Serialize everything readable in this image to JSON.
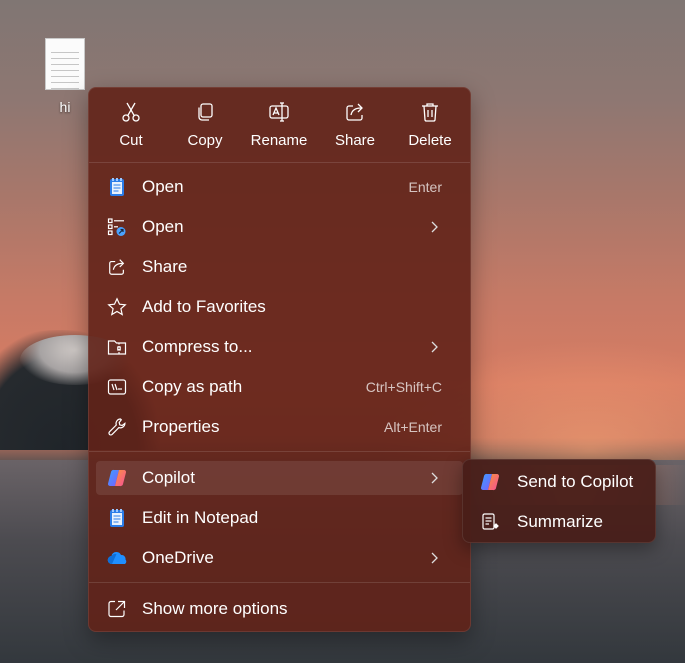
{
  "desktop": {
    "file_name": "hi"
  },
  "context_menu": {
    "actions": [
      {
        "label": "Cut",
        "icon": "scissors-icon"
      },
      {
        "label": "Copy",
        "icon": "copy-icon"
      },
      {
        "label": "Rename",
        "icon": "rename-icon"
      },
      {
        "label": "Share",
        "icon": "share-icon"
      },
      {
        "label": "Delete",
        "icon": "trash-icon"
      }
    ],
    "items": [
      {
        "label": "Open",
        "shortcut": "Enter",
        "icon": "notepad-icon"
      },
      {
        "label": "Open",
        "shortcut": "",
        "icon": "open-with-icon",
        "submenu": true
      },
      {
        "label": "Share",
        "shortcut": "",
        "icon": "share-icon"
      },
      {
        "label": "Add to Favorites",
        "shortcut": "",
        "icon": "star-icon"
      },
      {
        "label": "Compress to...",
        "shortcut": "",
        "icon": "zip-folder-icon",
        "submenu": true
      },
      {
        "label": "Copy as path",
        "shortcut": "Ctrl+Shift+C",
        "icon": "copy-path-icon"
      },
      {
        "label": "Properties",
        "shortcut": "Alt+Enter",
        "icon": "wrench-icon"
      },
      {
        "label": "Copilot",
        "shortcut": "",
        "icon": "copilot-icon",
        "submenu": true,
        "highlighted": true
      },
      {
        "label": "Edit in Notepad",
        "shortcut": "",
        "icon": "notepad-icon"
      },
      {
        "label": "OneDrive",
        "shortcut": "",
        "icon": "onedrive-cloud-icon",
        "submenu": true
      },
      {
        "label": "Show more options",
        "shortcut": "",
        "icon": "expand-icon"
      }
    ]
  },
  "copilot_submenu": {
    "items": [
      {
        "label": "Send to Copilot",
        "icon": "copilot-icon"
      },
      {
        "label": "Summarize",
        "icon": "summarize-icon"
      }
    ]
  },
  "colors": {
    "menu_bg": "#62221a",
    "accent_blue": "#4aa3ff",
    "text": "#ffffff"
  }
}
